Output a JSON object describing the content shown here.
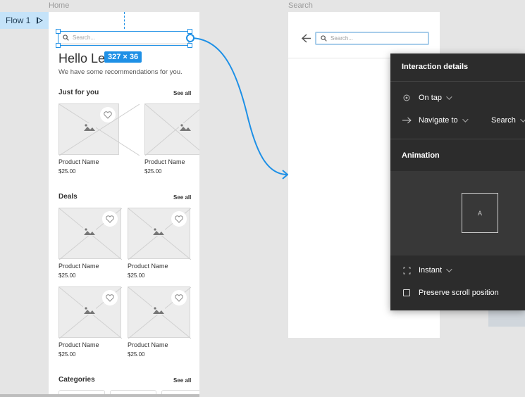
{
  "flow": {
    "label": "Flow 1"
  },
  "frames": {
    "home_label": "Home",
    "search_label": "Search"
  },
  "home": {
    "search_placeholder": "Search...",
    "greeting": "Hello Leslie!",
    "subtitle": "We have some recommendations for you.",
    "sections": [
      {
        "title": "Just for you",
        "see_all": "See all"
      },
      {
        "title": "Deals",
        "see_all": "See all"
      },
      {
        "title": "Categories",
        "see_all": "See all"
      }
    ],
    "products": [
      {
        "name": "Product Name",
        "price": "$25.00"
      },
      {
        "name": "Product Name",
        "price": "$25.00"
      },
      {
        "name": "Product Name",
        "price": "$25.00"
      },
      {
        "name": "Product Name",
        "price": "$25.00"
      },
      {
        "name": "Product Name",
        "price": "$25.00"
      },
      {
        "name": "Product Name",
        "price": "$25.00"
      }
    ]
  },
  "selection": {
    "dimensions": "327 × 36"
  },
  "search_frame": {
    "placeholder": "Search..."
  },
  "panel": {
    "title": "Interaction details",
    "trigger": "On tap",
    "action": "Navigate to",
    "destination": "Search",
    "animation_title": "Animation",
    "preview_label": "A",
    "animation_type": "Instant",
    "preserve_scroll": "Preserve scroll position"
  },
  "colors": {
    "accent": "#1e90e6",
    "panel_bg": "#2c2c2c",
    "canvas": "#e5e5e5"
  }
}
